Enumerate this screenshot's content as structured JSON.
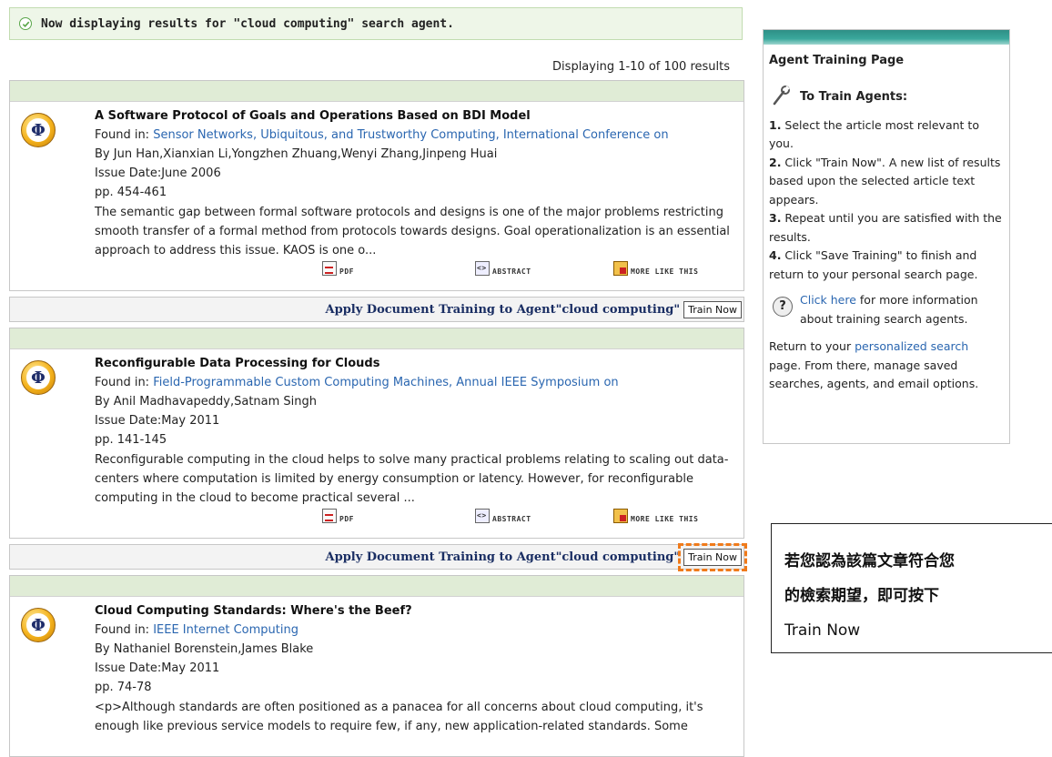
{
  "notice": {
    "text": "Now displaying results for \"cloud computing\" search agent."
  },
  "results_count": "Displaying 1-10 of 100 results",
  "actions": {
    "pdf": "PDF",
    "abstract": "ABSTRACT",
    "more": "MORE LIKE THIS"
  },
  "train": {
    "apply_label": "Apply Document Training to Agent\"cloud computing\"",
    "button_label": "Train Now"
  },
  "results": [
    {
      "title": "A Software Protocol of Goals and Operations Based on BDI Model",
      "found_prefix": "Found in: ",
      "found_in": "Sensor Networks, Ubiquitous, and Trustworthy Computing, International Conference on",
      "authors": "By Jun Han,Xianxian Li,Yongzhen Zhuang,Wenyi Zhang,Jinpeng Huai",
      "issue_date": "Issue Date:June 2006",
      "pages": "pp. 454-461",
      "abstract": "The semantic gap between formal software protocols and designs is one of the major problems restricting smooth transfer of a formal method from protocols towards designs. Goal operationalization is an essential approach to address this issue. KAOS is one o..."
    },
    {
      "title": "Reconfigurable Data Processing for Clouds",
      "found_prefix": "Found in: ",
      "found_in": "Field-Programmable Custom Computing Machines, Annual IEEE Symposium on",
      "authors": "By Anil Madhavapeddy,Satnam Singh",
      "issue_date": "Issue Date:May 2011",
      "pages": "pp. 141-145",
      "abstract": "Reconfigurable computing in the cloud helps to solve many practical problems relating to scaling out data-centers where computation is limited by energy consumption or latency. However, for reconfigurable computing in the cloud to become practical several ..."
    },
    {
      "title": "Cloud Computing Standards: Where's the Beef?",
      "found_prefix": "Found in: ",
      "found_in": "IEEE Internet Computing",
      "authors": "By Nathaniel Borenstein,James Blake",
      "issue_date": "Issue Date:May 2011",
      "pages": "pp. 74-78",
      "abstract": "<p>Although standards are often positioned as a panacea for all concerns about cloud computing, it's enough like previous service models to require few, if any, new application-related standards. Some"
    }
  ],
  "sidebar": {
    "title": "Agent Training Page",
    "subtitle": "To Train Agents:",
    "steps": [
      {
        "num": "1.",
        "text": " Select the article most relevant to you."
      },
      {
        "num": "2.",
        "text": " Click \"Train Now\". A new list of results based upon the selected article text appears."
      },
      {
        "num": "3.",
        "text": " Repeat until you are satisfied with the results."
      },
      {
        "num": "4.",
        "text": " Click \"Save Training\" to finish and return to your personal search page."
      }
    ],
    "help_link": "Click here",
    "help_text": " for more information about training search agents.",
    "return_prefix": "Return to your ",
    "return_link": "personalized search",
    "return_suffix": " page. From there, manage saved searches, agents, and email options."
  },
  "annotation": {
    "line1": "若您認為該篇文章符合您",
    "line2": "的檢索期望，即可按下",
    "line3": "Train Now"
  }
}
